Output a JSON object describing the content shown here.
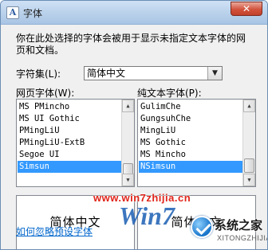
{
  "window": {
    "title": "字体",
    "close_label": "✕"
  },
  "dialog": {
    "description": "你在此处选择的字体会被用于显示未指定文本字体的网页和文档。",
    "charset_label": "字符集(L):",
    "charset_value": "简体中文",
    "web_font_label": "网页字体(W):",
    "plain_font_label": "纯文本字体(P):",
    "web_fonts": [
      "MS PMincho",
      "MS UI Gothic",
      "PMingLiU",
      "PMingLiU-ExtB",
      "Segoe UI",
      "Simsun"
    ],
    "web_selected_index": 5,
    "plain_fonts": [
      "GulimChe",
      "GungsuhChe",
      "MingLiU",
      "MS Gothic",
      "MS Mincho",
      "NSimsun"
    ],
    "plain_selected_index": 5,
    "web_preview_text": "简体中文",
    "plain_preview_text": "简体中文",
    "ignore_link": "如何忽略预设字体"
  },
  "watermark": {
    "url": "www.win7zhijia.cn",
    "logo_text": "Win7",
    "site_name": "系统之家",
    "site_domain": "XITONGZHIJIA.NET"
  }
}
